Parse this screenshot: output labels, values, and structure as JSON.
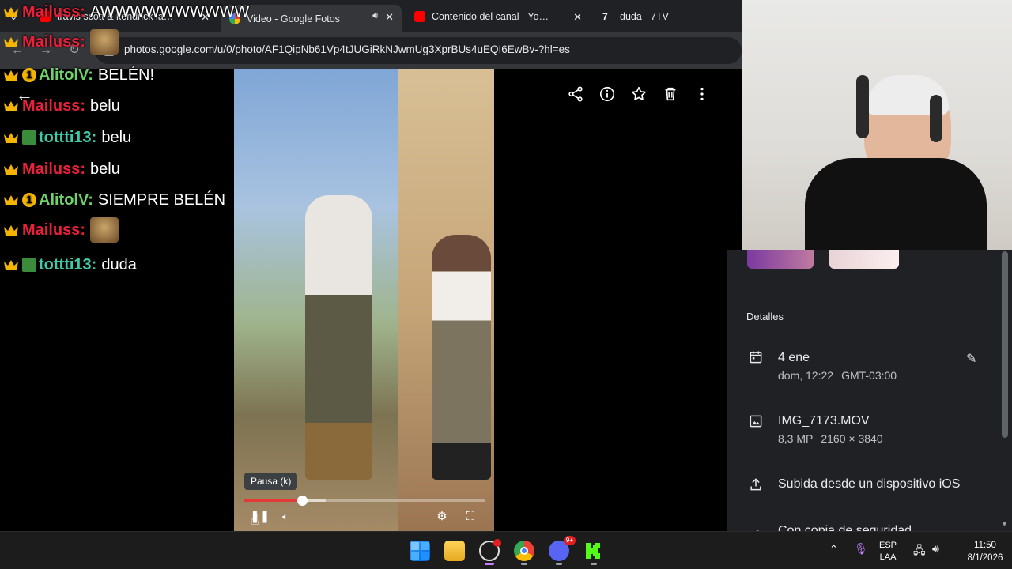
{
  "browser": {
    "tabs": [
      {
        "title": "travis scott & kendrick lamar -",
        "favicon_color": "#ff0000"
      },
      {
        "title": "Video - Google Fotos",
        "favicon_color": "#fbbc04"
      },
      {
        "title": "Contenido del canal - YouTube",
        "favicon_color": "#ff0000"
      },
      {
        "title": "duda - 7TV",
        "favicon_color": "#ffffff"
      }
    ],
    "url": "photos.google.com/u/0/photo/AF1QipNb61Vp4tJUGiRkNJwmUg3XprBUs4uEQI6EwBv-?hl=es"
  },
  "chat": {
    "messages": [
      {
        "user": "Mailuss",
        "user_color": "#e8203a",
        "sep": ":",
        "text": "AWWWWWWWWWW",
        "badge": "crown"
      },
      {
        "user": "Mailuss",
        "user_color": "#e8203a",
        "sep": ":",
        "text": "",
        "badge": "crown",
        "emote": true
      },
      {
        "user": "AlitolV",
        "user_color": "#6ed16a",
        "sep": ":",
        "text": "BELÉN!",
        "badge": "one"
      },
      {
        "user": "Mailuss",
        "user_color": "#e8203a",
        "sep": ":",
        "text": "belu",
        "badge": "crown"
      },
      {
        "user": "tottti13",
        "user_color": "#3fc9a7",
        "sep": ":",
        "text": "belu",
        "badge": "square"
      },
      {
        "user": "Mailuss",
        "user_color": "#e8203a",
        "sep": ":",
        "text": "belu",
        "badge": "crown"
      },
      {
        "user": "AlitolV",
        "user_color": "#6ed16a",
        "sep": ":",
        "text": "SIEMPRE BELÉN",
        "badge": "one"
      },
      {
        "user": "Mailuss",
        "user_color": "#e8203a",
        "sep": ":",
        "text": "",
        "badge": "crown",
        "emote": true
      },
      {
        "user": "tottti13",
        "user_color": "#3fc9a7",
        "sep": ":",
        "text": "duda",
        "badge": "square"
      }
    ]
  },
  "player": {
    "tooltip": "Pausa (k)",
    "progress_played": 0.24,
    "progress_buffered": 0.34
  },
  "details": {
    "section_title": "Detalles",
    "date_main": "4 ene",
    "date_day": "dom, 12:22",
    "date_tz": "GMT-03:00",
    "file_name": "IMG_7173.MOV",
    "file_mp": "8,3 MP",
    "file_res": "2160 × 3840",
    "upload_text": "Subida desde un dispositivo iOS",
    "backup_text": "Con copia de seguridad"
  },
  "taskbar": {
    "lang_top": "ESP",
    "lang_bottom": "LAA",
    "time": "11:50",
    "date": "8/1/2026",
    "discord_badge": "9+"
  }
}
